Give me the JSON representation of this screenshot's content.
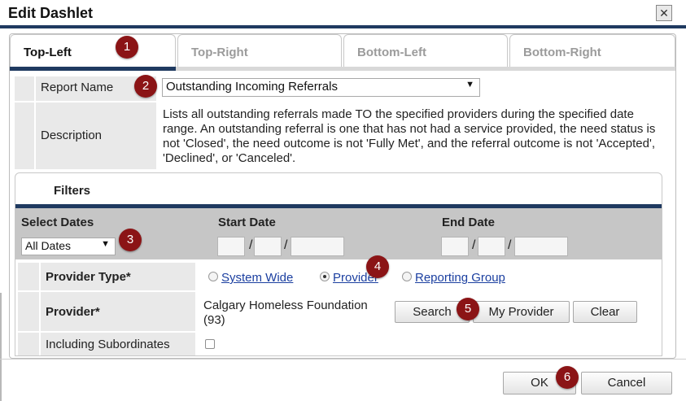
{
  "dialog": {
    "title": "Edit Dashlet"
  },
  "tabs": [
    {
      "label": "Top-Left",
      "active": true
    },
    {
      "label": "Top-Right",
      "active": false
    },
    {
      "label": "Bottom-Left",
      "active": false
    },
    {
      "label": "Bottom-Right",
      "active": false
    }
  ],
  "report": {
    "name_label": "Report Name",
    "name_value": "Outstanding Incoming Referrals",
    "description_label": "Description",
    "description_text": "Lists all outstanding referrals made TO the specified providers during the specified date range. An outstanding referral is one that has not had a service provided, the need status is not 'Closed', the need outcome is not 'Fully Met', and the referral outcome is not 'Accepted', 'Declined', or 'Canceled'."
  },
  "filters": {
    "title": "Filters",
    "select_dates_label": "Select Dates",
    "select_dates_value": "All Dates",
    "start_date_label": "Start Date",
    "end_date_label": "End Date",
    "date_separator": "/",
    "provider_type_label": "Provider Type",
    "required_mark": "*",
    "provider_type_options": [
      {
        "label": "System Wide",
        "selected": false
      },
      {
        "label": "Provider",
        "selected": true
      },
      {
        "label": "Reporting Group",
        "selected": false
      }
    ],
    "provider_label": "Provider",
    "provider_value": "Calgary Homeless Foundation (93)",
    "search_button": "Search",
    "my_provider_button": "My Provider",
    "clear_button": "Clear",
    "including_subordinates_label": "Including Subordinates",
    "including_subordinates_checked": false
  },
  "footer": {
    "ok_button": "OK",
    "cancel_button": "Cancel"
  },
  "badges": [
    "1",
    "2",
    "3",
    "4",
    "5",
    "6"
  ],
  "colors": {
    "accent": "#1f3a60",
    "badge": "#8b1416",
    "link": "#1b3fa0"
  },
  "icons": {
    "close": "close-icon",
    "dropdown": "chevron-down-icon"
  }
}
